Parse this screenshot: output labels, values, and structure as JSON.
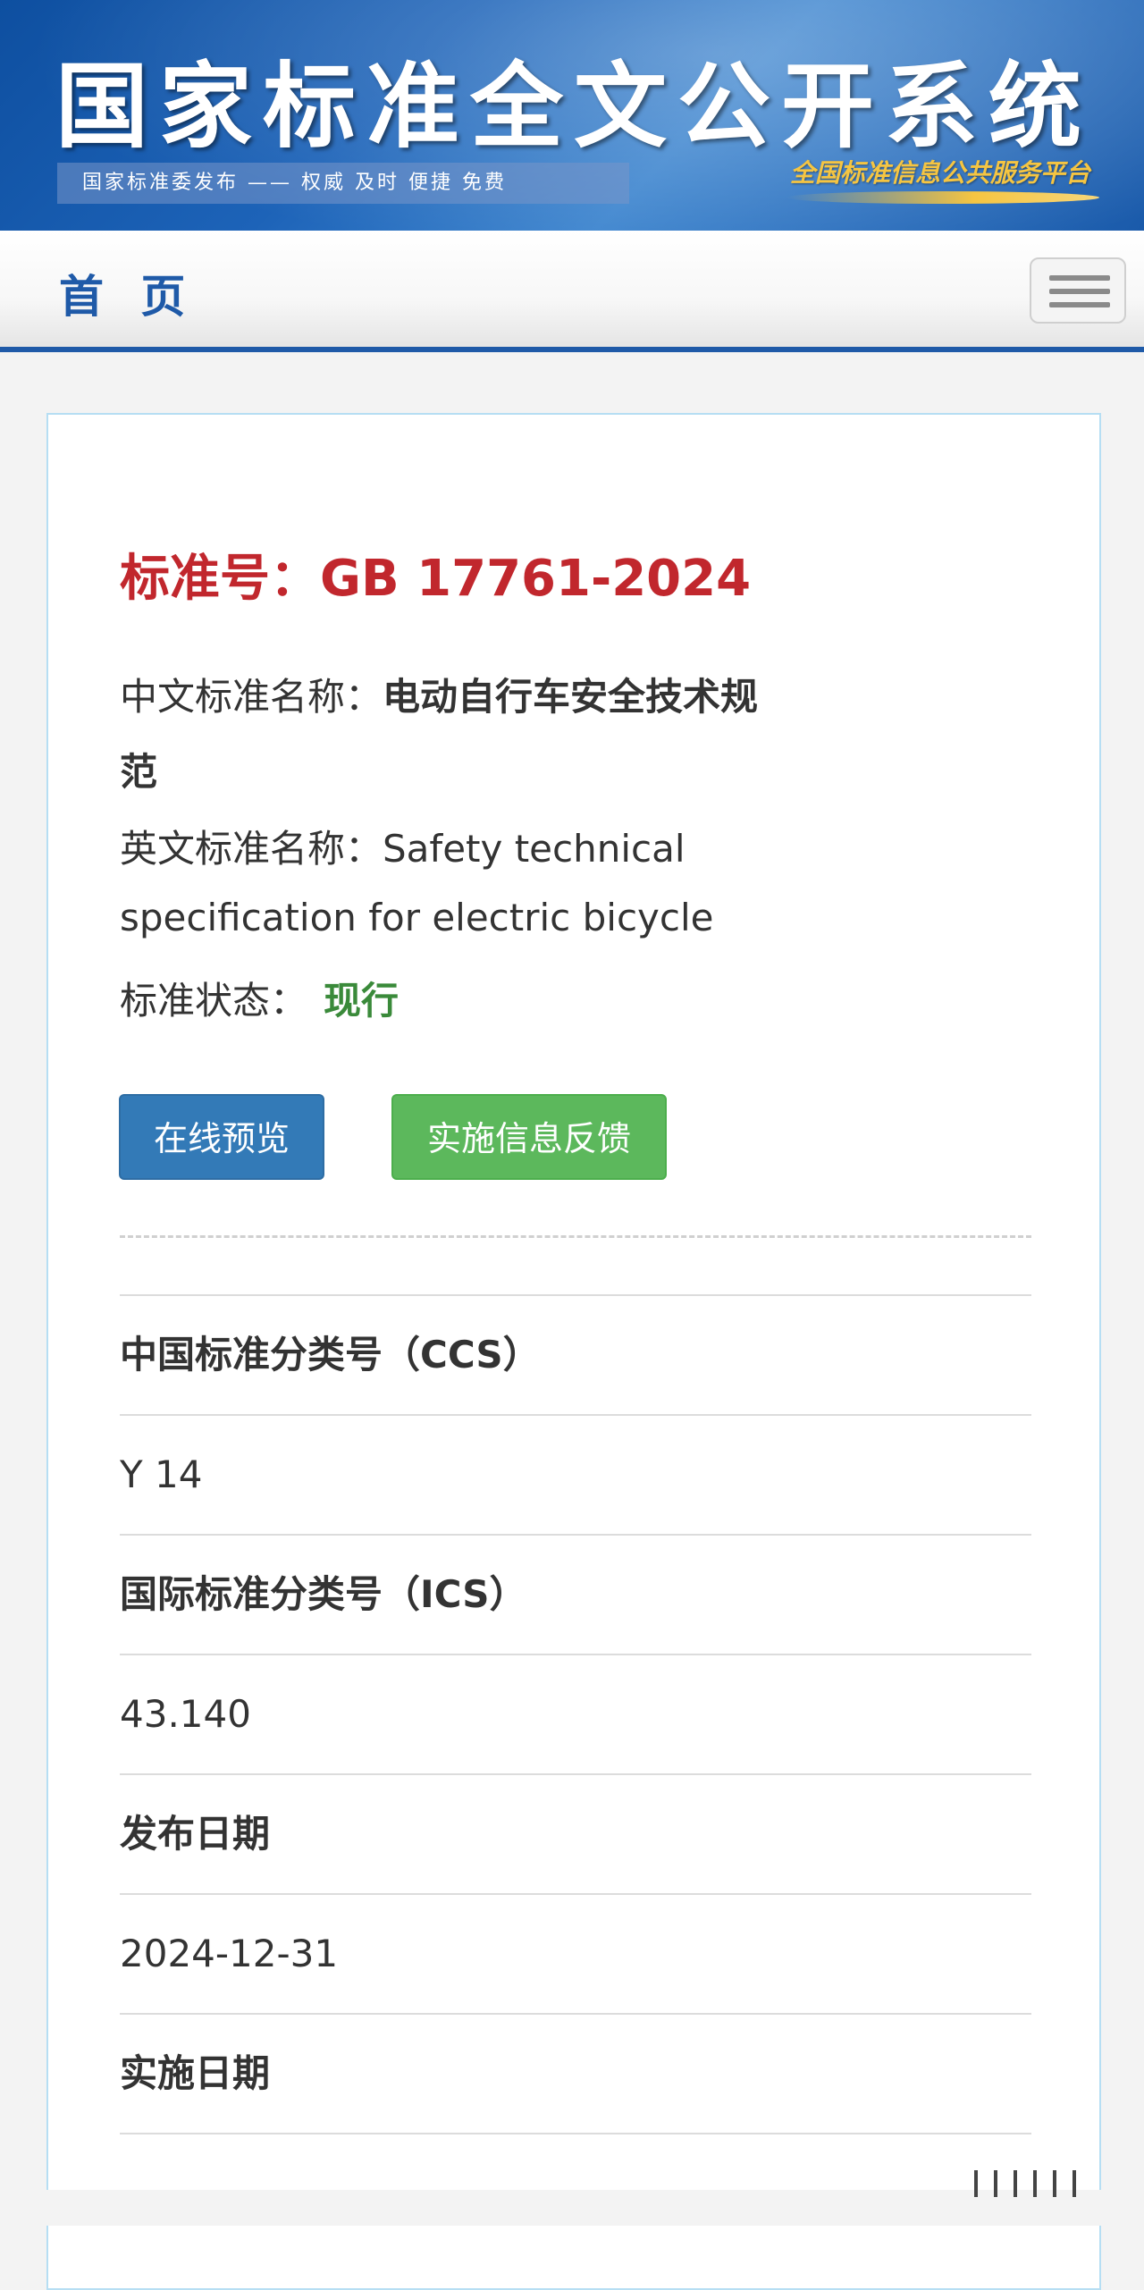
{
  "banner": {
    "title": "国家标准全文公开系统",
    "subtitle": "国家标准委发布 —— 权威 及时 便捷 免费",
    "slogan": "全国标准信息公共服务平台"
  },
  "nav": {
    "home_label": "首 页",
    "menu_icon": "hamburger-menu-icon"
  },
  "standard": {
    "number_label": "标准号：",
    "number": "GB 17761-2024",
    "cn_name_label": "中文标准名称：",
    "cn_name": "电动自行车安全技术规",
    "cn_name_cont": "范",
    "en_name_label": "英文标准名称：",
    "en_name": "Safety technical",
    "en_name_cont": "specification for electric bicycle",
    "status_label": "标准状态：",
    "status": "现行"
  },
  "actions": {
    "preview": "在线预览",
    "feedback": "实施信息反馈"
  },
  "details": {
    "ccs_label": "中国标准分类号（CCS）",
    "ccs_value": "Y 14",
    "ics_label": "国际标准分类号（ICS）",
    "ics_value": "43.140",
    "publish_label": "发布日期",
    "publish_value": "2024-12-31",
    "effective_label": "实施日期"
  },
  "colors": {
    "accent_blue": "#1f5aa8",
    "standard_red": "#c1272d",
    "status_green": "#3a8a3a",
    "btn_blue": "#337ab7",
    "btn_green": "#5cb85c"
  }
}
